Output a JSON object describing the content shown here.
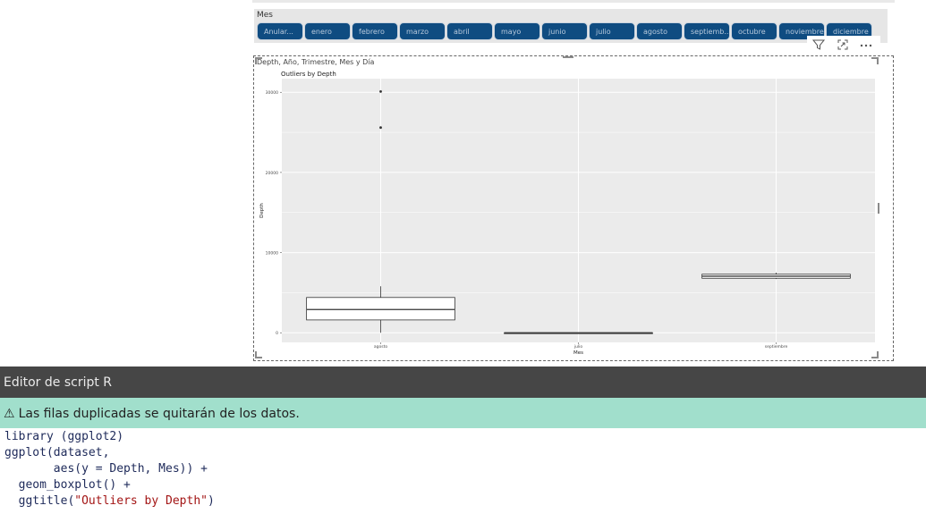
{
  "slicer": {
    "title": "Mes",
    "months": [
      "Anular...",
      "enero",
      "febrero",
      "marzo",
      "abril",
      "mayo",
      "junio",
      "julio",
      "agosto",
      "septiemb...",
      "octubre",
      "noviembre",
      "diciembre"
    ]
  },
  "visual": {
    "title": "Depth, Año, Trimestre, Mes y Día",
    "header_icons": [
      "filter-icon",
      "focus-mode-icon",
      "more-options-icon"
    ]
  },
  "chart_data": {
    "type": "box",
    "title": "Outliers by Depth",
    "xlabel": "Mes",
    "ylabel": "Depth",
    "categories": [
      "agosto",
      "julio",
      "septiembre"
    ],
    "yticks": [
      0,
      10000,
      20000,
      30000
    ],
    "ylim": [
      -1200,
      31700
    ],
    "boxes": [
      {
        "category": "agosto",
        "whisker_low": 0,
        "q1": 1600,
        "median": 2900,
        "q3": 4400,
        "whisker_high": 5800,
        "outliers": [
          25600,
          30100
        ]
      },
      {
        "category": "julio",
        "whisker_low": 0,
        "q1": 0,
        "median": 0,
        "q3": 0,
        "whisker_high": 0,
        "outliers": []
      },
      {
        "category": "septiembre",
        "whisker_low": 6700,
        "q1": 6800,
        "median": 7050,
        "q3": 7300,
        "whisker_high": 7500,
        "outliers": []
      }
    ],
    "grid": true,
    "legend": "none",
    "colors": {
      "panel": "#ebebeb",
      "grid": "#ffffff",
      "box": "#333333"
    }
  },
  "editor": {
    "title": "Editor de script R",
    "warning": "Las filas duplicadas se quitarán de los datos.",
    "code_lines": [
      "library (ggplot2)",
      "ggplot(dataset,",
      "       aes(y = Depth, Mes)) +",
      "  geom_boxplot() +",
      "  ggtitle(\"Outliers by Depth\")"
    ]
  }
}
